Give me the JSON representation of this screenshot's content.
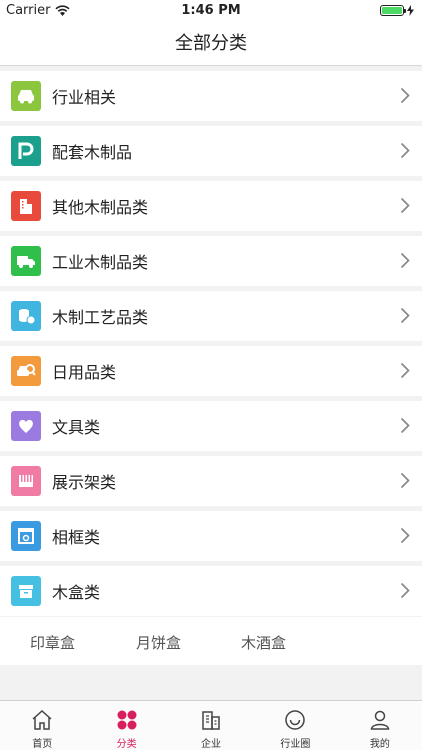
{
  "status_bar": {
    "carrier": "Carrier",
    "time": "1:46 PM",
    "battery_level": 1.0
  },
  "nav": {
    "title": "全部分类"
  },
  "categories": [
    {
      "label": "行业相关",
      "icon": "car-icon",
      "color": "#8cc63f"
    },
    {
      "label": "配套木制品",
      "icon": "parking-icon",
      "color": "#1aa08c"
    },
    {
      "label": "其他木制品类",
      "icon": "building-icon",
      "color": "#e84a3c"
    },
    {
      "label": "工业木制品类",
      "icon": "truck-icon",
      "color": "#2fbf4a"
    },
    {
      "label": "木制工艺品类",
      "icon": "coins-icon",
      "color": "#3fb5e0"
    },
    {
      "label": "日用品类",
      "icon": "car-search-icon",
      "color": "#f39a3c"
    },
    {
      "label": "文具类",
      "icon": "heart-icon",
      "color": "#9b7be0"
    },
    {
      "label": "展示架类",
      "icon": "piano-icon",
      "color": "#f07ba5"
    },
    {
      "label": "相框类",
      "icon": "frame-icon",
      "color": "#3a9be0"
    },
    {
      "label": "木盒类",
      "icon": "box-icon",
      "color": "#45c0e2"
    }
  ],
  "sub_items": [
    "印章盒",
    "月饼盒",
    "木酒盒"
  ],
  "tabs": [
    {
      "label": "首页",
      "icon": "home-icon",
      "active": false
    },
    {
      "label": "分类",
      "icon": "category-icon",
      "active": true
    },
    {
      "label": "企业",
      "icon": "enterprise-icon",
      "active": false
    },
    {
      "label": "行业圈",
      "icon": "circle-icon",
      "active": false
    },
    {
      "label": "我的",
      "icon": "user-icon",
      "active": false
    }
  ],
  "colors": {
    "accent": "#d81e5b",
    "chevron": "#888888",
    "battery": "#4cd964"
  }
}
